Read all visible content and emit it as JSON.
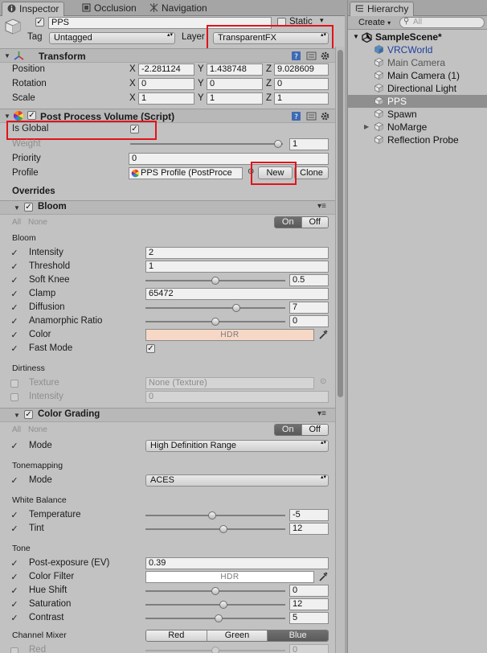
{
  "inspector": {
    "tabs": [
      {
        "label": "Inspector",
        "icon": "info-icon"
      },
      {
        "label": "Occlusion",
        "icon": "occlusion-icon"
      },
      {
        "label": "Navigation",
        "icon": "navigation-icon"
      }
    ],
    "object": {
      "name": "PPS",
      "static_label": "Static",
      "tag_label": "Tag",
      "tag_value": "Untagged",
      "layer_label": "Layer",
      "layer_value": "TransparentFX"
    },
    "transform": {
      "title": "Transform",
      "axis_x": "X",
      "axis_y": "Y",
      "axis_z": "Z",
      "rows": [
        {
          "label": "Position",
          "x": "-2.281124",
          "y": "1.438748",
          "z": "9.028609"
        },
        {
          "label": "Rotation",
          "x": "0",
          "y": "0",
          "z": "0"
        },
        {
          "label": "Scale",
          "x": "1",
          "y": "1",
          "z": "1"
        }
      ]
    },
    "ppv": {
      "title": "Post Process Volume (Script)",
      "is_global_label": "Is Global",
      "weight_label": "Weight",
      "weight_value": "1",
      "weight_fraction": 1.0,
      "priority_label": "Priority",
      "priority_value": "0",
      "profile_label": "Profile",
      "profile_value": "PPS Profile (PostProce",
      "new_button": "New",
      "clone_button": "Clone",
      "overrides_label": "Overrides"
    },
    "all_label": "All",
    "none_label": "None",
    "on_label": "On",
    "off_label": "Off",
    "bloom": {
      "title": "Bloom",
      "section_bloom": "Bloom",
      "intensity_label": "Intensity",
      "intensity_value": "2",
      "threshold_label": "Threshold",
      "threshold_value": "1",
      "softknee_label": "Soft Knee",
      "softknee_value": "0.5",
      "softknee_fraction": 0.5,
      "clamp_label": "Clamp",
      "clamp_value": "65472",
      "diffusion_label": "Diffusion",
      "diffusion_value": "7",
      "diffusion_fraction": 0.66,
      "anamorphic_label": "Anamorphic Ratio",
      "anamorphic_value": "0",
      "anamorphic_fraction": 0.5,
      "color_label": "Color",
      "color_hdr": "HDR",
      "color_hex": "#f7d7c6",
      "fastmode_label": "Fast Mode",
      "section_dirtiness": "Dirtiness",
      "texture_label": "Texture",
      "texture_value": "None (Texture)",
      "dirt_intensity_label": "Intensity",
      "dirt_intensity_value": "0"
    },
    "color_grading": {
      "title": "Color Grading",
      "mode_label": "Mode",
      "mode_value": "High Definition Range",
      "section_tonemapping": "Tonemapping",
      "tonemap_mode_label": "Mode",
      "tonemap_mode_value": "ACES",
      "section_white_balance": "White Balance",
      "temperature_label": "Temperature",
      "temperature_value": "-5",
      "temperature_fraction": 0.475,
      "tint_label": "Tint",
      "tint_value": "12",
      "tint_fraction": 0.56,
      "section_tone": "Tone",
      "postexposure_label": "Post-exposure (EV)",
      "postexposure_value": "0.39",
      "colorfilter_label": "Color Filter",
      "colorfilter_hdr": "HDR",
      "colorfilter_hex": "#ffffff",
      "hueshift_label": "Hue Shift",
      "hueshift_value": "0",
      "hueshift_fraction": 0.5,
      "saturation_label": "Saturation",
      "saturation_value": "12",
      "saturation_fraction": 0.56,
      "contrast_label": "Contrast",
      "contrast_value": "5",
      "contrast_fraction": 0.525,
      "channel_mixer_label": "Channel Mixer",
      "channel_tabs": [
        "Red",
        "Green",
        "Blue"
      ],
      "channel_selected": "Blue",
      "red_label": "Red",
      "red_value": "0",
      "red_fraction": 0.5
    }
  },
  "hierarchy": {
    "tab": "Hierarchy",
    "create_label": "Create",
    "search_placeholder": "All",
    "scene": "SampleScene*",
    "items": [
      {
        "label": "VRCWorld",
        "selected": false
      },
      {
        "label": "Main Camera",
        "selected": false
      },
      {
        "label": "Main Camera (1)",
        "selected": false
      },
      {
        "label": "Directional Light",
        "selected": false
      },
      {
        "label": "PPS",
        "selected": true
      },
      {
        "label": "Spawn",
        "selected": false
      },
      {
        "label": "NoMarge",
        "selected": false
      },
      {
        "label": "Reflection Probe",
        "selected": false
      }
    ]
  },
  "colors": {
    "panel": "#c2c2c2",
    "highlight_box": "#e0141a",
    "selected_row": "#8f8f8f",
    "prefab_blue": "#1f3f9e"
  }
}
